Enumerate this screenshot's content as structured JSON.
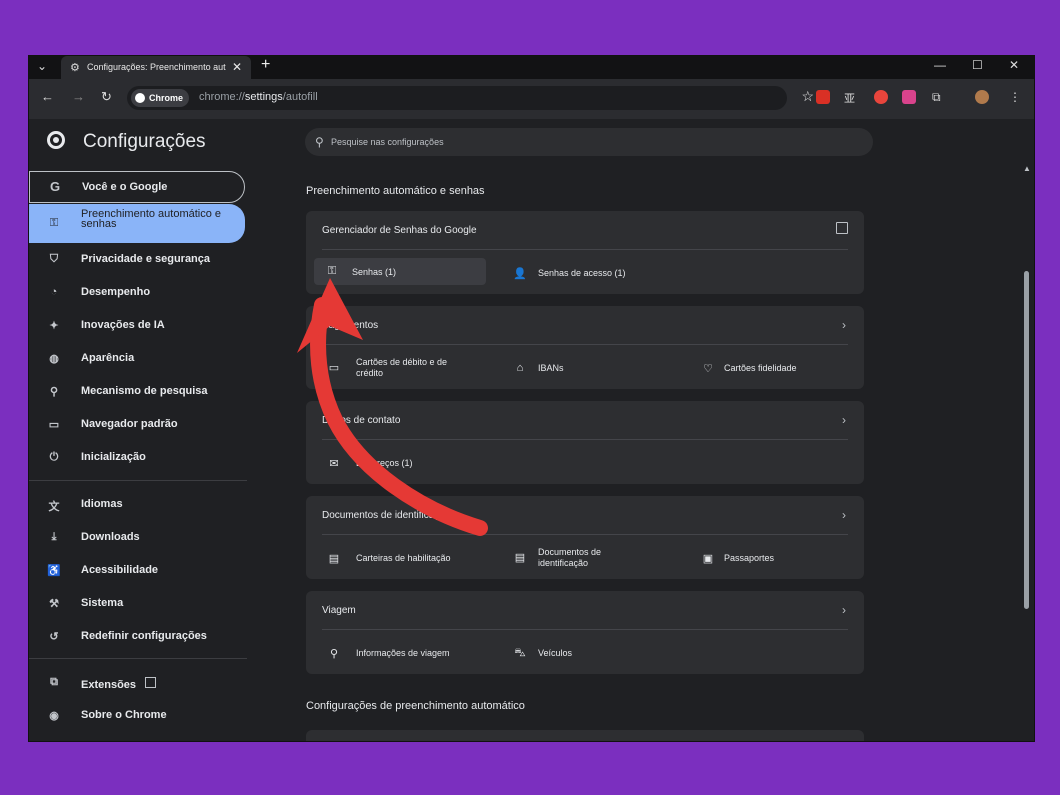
{
  "browser": {
    "tab_title": "Configurações: Preenchimento aut",
    "close_glyph": "✕",
    "new_tab_glyph": "+",
    "chip_label": "Chrome",
    "url_prefix": "chrome://",
    "url_host": "settings",
    "url_path": "/autofill"
  },
  "header": {
    "title": "Configurações",
    "search_placeholder": "Pesquise nas configurações"
  },
  "sidebar": {
    "items": [
      {
        "label": "Você e o Google",
        "icon": "google-g-icon"
      },
      {
        "label": "Preenchimento automático e senhas",
        "icon": "key-icon"
      },
      {
        "label": "Privacidade e segurança",
        "icon": "shield-icon"
      },
      {
        "label": "Desempenho",
        "icon": "gauge-icon"
      },
      {
        "label": "Inovações de IA",
        "icon": "sparkle-icon"
      },
      {
        "label": "Aparência",
        "icon": "palette-icon"
      },
      {
        "label": "Mecanismo de pesquisa",
        "icon": "search-icon"
      },
      {
        "label": "Navegador padrão",
        "icon": "browser-window-icon"
      },
      {
        "label": "Inicialização",
        "icon": "power-icon"
      },
      {
        "label": "Idiomas",
        "icon": "translate-icon"
      },
      {
        "label": "Downloads",
        "icon": "download-icon"
      },
      {
        "label": "Acessibilidade",
        "icon": "accessibility-icon"
      },
      {
        "label": "Sistema",
        "icon": "wrench-icon"
      },
      {
        "label": "Redefinir configurações",
        "icon": "reset-icon"
      },
      {
        "label": "Extensões",
        "icon": "puzzle-icon"
      },
      {
        "label": "Sobre o Chrome",
        "icon": "chrome-logo-icon"
      }
    ]
  },
  "main": {
    "section_title": "Preenchimento automático e senhas",
    "section2_title": "Configurações de preenchimento automático",
    "cards": {
      "passwords": {
        "title": "Gerenciador de Senhas do Google",
        "items": [
          "Senhas (1)",
          "Senhas de acesso (1)"
        ]
      },
      "payments": {
        "title": "Pagamentos",
        "items": [
          "Cartões de débito e de crédito",
          "IBANs",
          "Cartões fidelidade"
        ]
      },
      "contact": {
        "title": "Dados de contato",
        "items": [
          "Endereços (1)"
        ]
      },
      "ids": {
        "title": "Documentos de identificação",
        "items": [
          "Carteiras de habilitação",
          "Documentos de identificação",
          "Passaportes"
        ]
      },
      "travel": {
        "title": "Viagem",
        "items": [
          "Informações de viagem",
          "Veículos"
        ]
      }
    }
  },
  "colors": {
    "page_bg": "#7b2fbf",
    "active_item_bg": "#8ab4f8",
    "arrow": "#e53935"
  }
}
